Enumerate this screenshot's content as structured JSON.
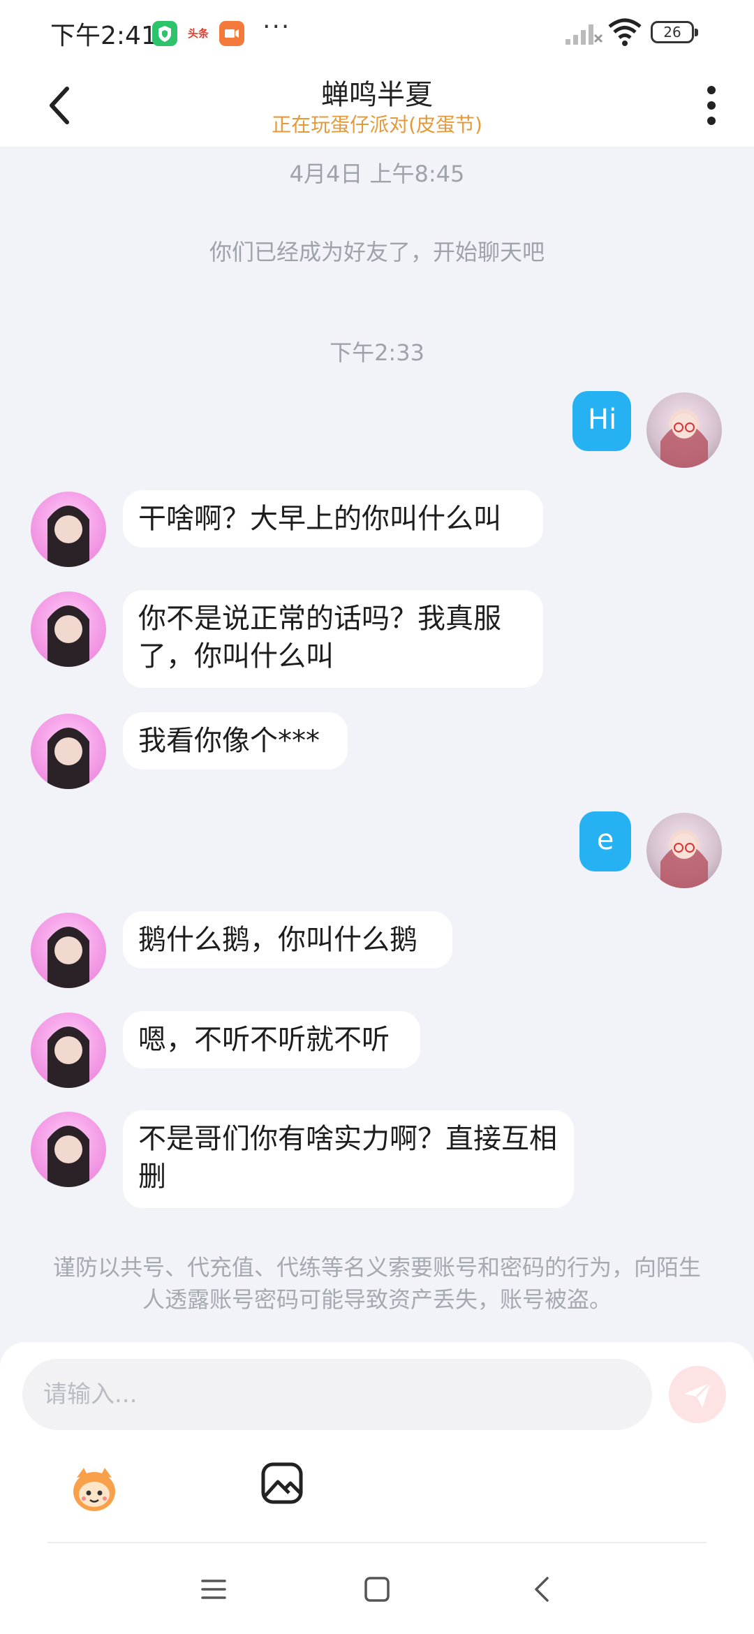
{
  "status_bar": {
    "time": "下午2:41",
    "app_badge_2": "头条",
    "more_dots": "···",
    "battery": "26"
  },
  "header": {
    "title": "蝉鸣半夏",
    "subtitle": "正在玩蛋仔派对(皮蛋节)"
  },
  "chat": {
    "timestamp_1": "4月4日 上午8:45",
    "system_notice": "你们已经成为好友了，开始聊天吧",
    "timestamp_2": "下午2:33",
    "messages": [
      {
        "sender": "me",
        "text": "Hi"
      },
      {
        "sender": "them",
        "text": "干啥啊？大早上的你叫什么叫"
      },
      {
        "sender": "them",
        "text": "你不是说正常的话吗？我真服了，你叫什么叫"
      },
      {
        "sender": "them",
        "text": "我看你像个***"
      },
      {
        "sender": "me",
        "text": "e"
      },
      {
        "sender": "them",
        "text": "鹅什么鹅，你叫什么鹅"
      },
      {
        "sender": "them",
        "text": "嗯，不听不听就不听"
      },
      {
        "sender": "them",
        "text": "不是哥们你有啥实力啊？直接互相删"
      }
    ],
    "warning": "谨防以共号、代充值、代练等名义索要账号和密码的行为，向陌生人透露账号密码可能导致资产丢失，账号被盗。"
  },
  "composer": {
    "placeholder": "请输入..."
  },
  "colors": {
    "my_bubble": "#26b1f3",
    "their_bubble": "#ffffff",
    "subtitle": "#e59a3a",
    "background": "#f1f3f8"
  },
  "icons": [
    "back-arrow-icon",
    "more-vertical-icon",
    "send-icon",
    "emoji-mascot-icon",
    "image-icon",
    "menu-icon",
    "home-square-icon",
    "nav-back-icon"
  ]
}
